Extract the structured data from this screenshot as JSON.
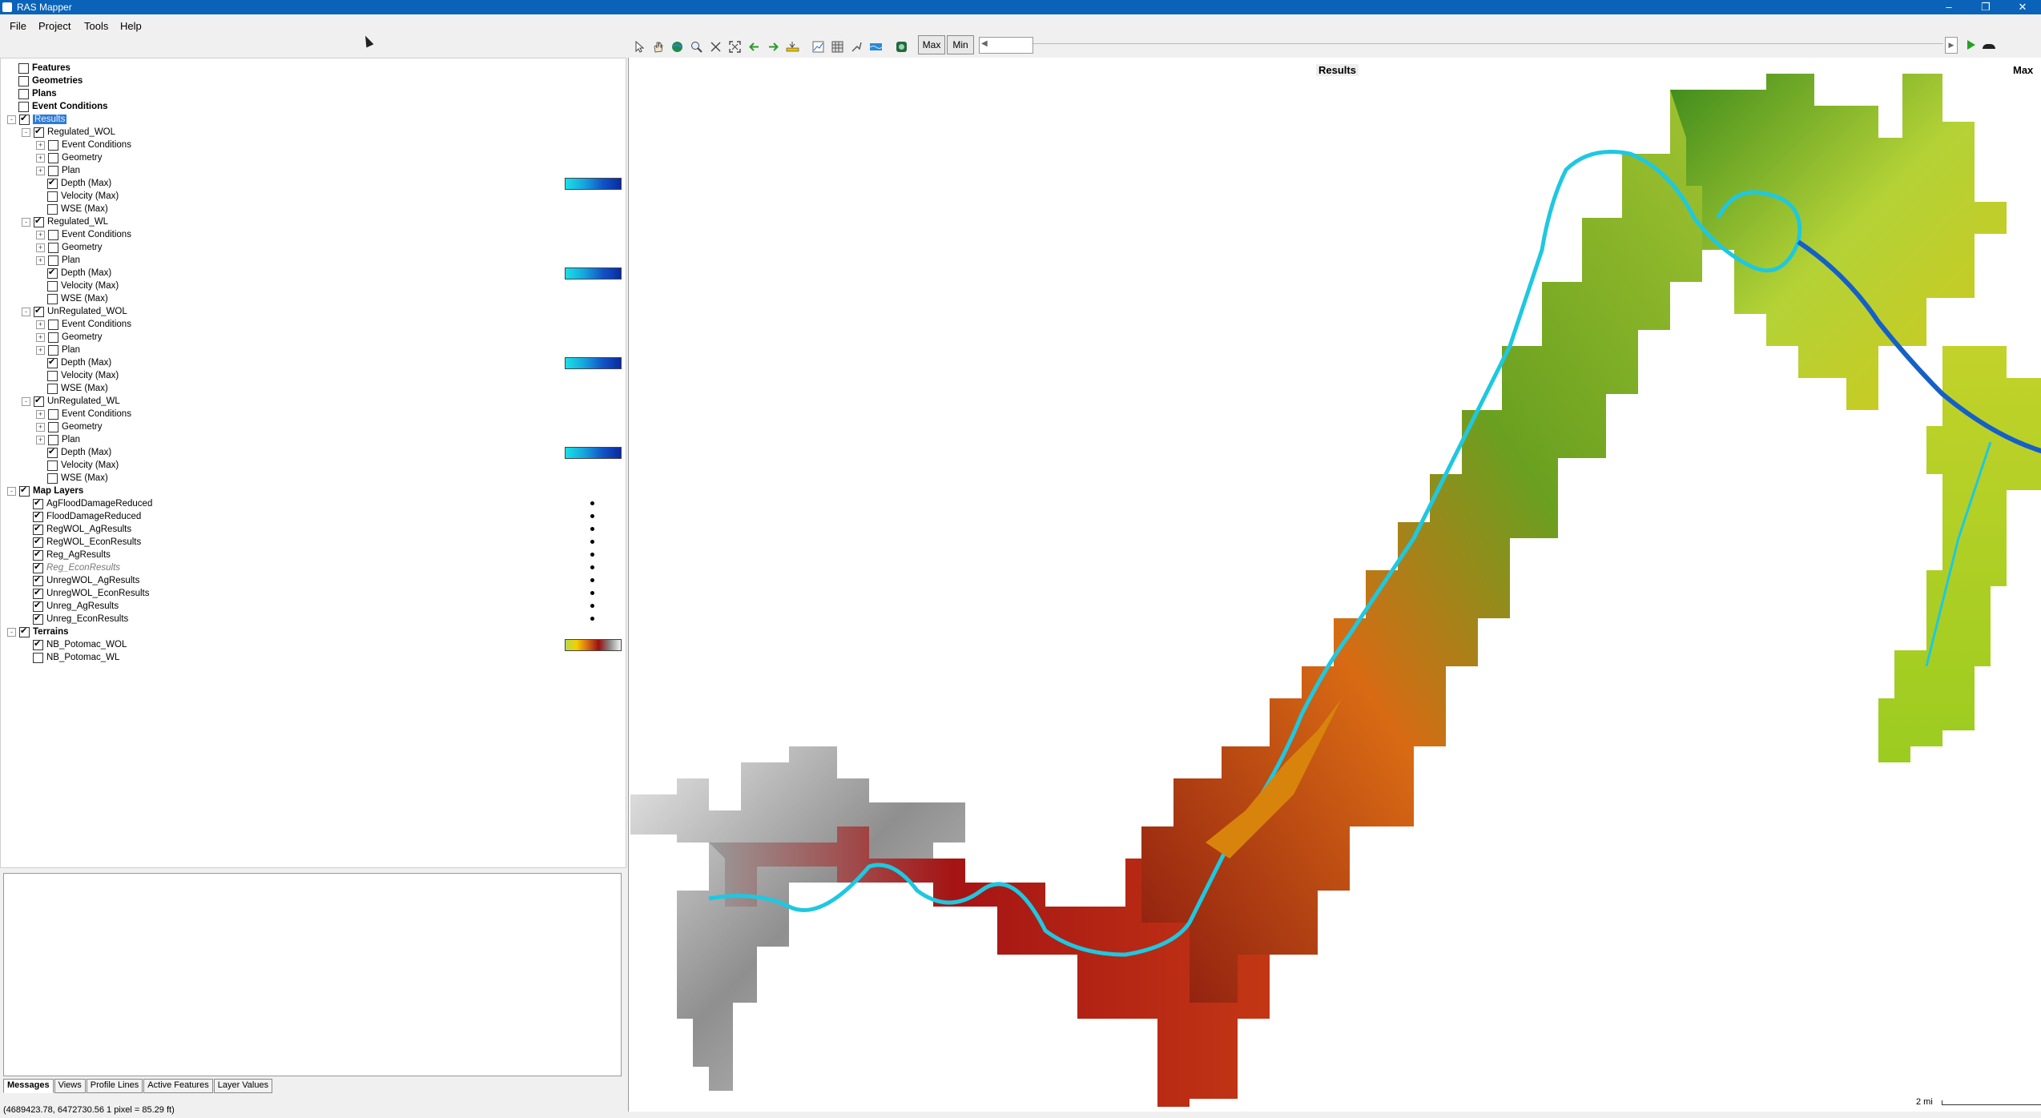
{
  "window": {
    "title": "RAS Mapper",
    "controls": [
      "–",
      "❐",
      "✕"
    ]
  },
  "menu": [
    "File",
    "Project",
    "Tools",
    "Help"
  ],
  "toolbar": {
    "max_label": "Max",
    "min_label": "Min"
  },
  "tree": {
    "top": [
      {
        "label": "Features",
        "checked": false,
        "bold": true
      },
      {
        "label": "Geometries",
        "checked": false,
        "bold": true
      },
      {
        "label": "Plans",
        "checked": false,
        "bold": true
      },
      {
        "label": "Event Conditions",
        "checked": false,
        "bold": true
      }
    ],
    "results_label": "Results",
    "results": [
      {
        "label": "Regulated_WOL",
        "checked": true,
        "children": [
          {
            "label": "Event Conditions",
            "checked": false,
            "expandable": true
          },
          {
            "label": "Geometry",
            "checked": false,
            "expandable": true
          },
          {
            "label": "Plan",
            "checked": false,
            "expandable": true
          },
          {
            "label": "Depth (Max)",
            "checked": true,
            "legend": true
          },
          {
            "label": "Velocity (Max)",
            "checked": false
          },
          {
            "label": "WSE (Max)",
            "checked": false
          }
        ]
      },
      {
        "label": "Regulated_WL",
        "checked": true,
        "children": [
          {
            "label": "Event Conditions",
            "checked": false,
            "expandable": true
          },
          {
            "label": "Geometry",
            "checked": false,
            "expandable": true
          },
          {
            "label": "Plan",
            "checked": false,
            "expandable": true
          },
          {
            "label": "Depth (Max)",
            "checked": true,
            "legend": true
          },
          {
            "label": "Velocity (Max)",
            "checked": false
          },
          {
            "label": "WSE (Max)",
            "checked": false
          }
        ]
      },
      {
        "label": "UnRegulated_WOL",
        "checked": true,
        "children": [
          {
            "label": "Event Conditions",
            "checked": false,
            "expandable": true
          },
          {
            "label": "Geometry",
            "checked": false,
            "expandable": true
          },
          {
            "label": "Plan",
            "checked": false,
            "expandable": true
          },
          {
            "label": "Depth (Max)",
            "checked": true,
            "legend": true
          },
          {
            "label": "Velocity (Max)",
            "checked": false
          },
          {
            "label": "WSE (Max)",
            "checked": false
          }
        ]
      },
      {
        "label": "UnRegulated_WL",
        "checked": true,
        "children": [
          {
            "label": "Event Conditions",
            "checked": false,
            "expandable": true
          },
          {
            "label": "Geometry",
            "checked": false,
            "expandable": true
          },
          {
            "label": "Plan",
            "checked": false,
            "expandable": true
          },
          {
            "label": "Depth (Max)",
            "checked": true,
            "legend": true
          },
          {
            "label": "Velocity (Max)",
            "checked": false
          },
          {
            "label": "WSE (Max)",
            "checked": false
          }
        ]
      }
    ],
    "map_layers_label": "Map Layers",
    "map_layers": [
      {
        "label": "AgFloodDamageReduced",
        "checked": true
      },
      {
        "label": "FloodDamageReduced",
        "checked": true
      },
      {
        "label": "RegWOL_AgResults",
        "checked": true
      },
      {
        "label": "RegWOL_EconResults",
        "checked": true
      },
      {
        "label": "Reg_AgResults",
        "checked": true
      },
      {
        "label": "Reg_EconResults",
        "checked": true,
        "italic": true
      },
      {
        "label": "UnregWOL_AgResults",
        "checked": true
      },
      {
        "label": "UnregWOL_EconResults",
        "checked": true
      },
      {
        "label": "Unreg_AgResults",
        "checked": true
      },
      {
        "label": "Unreg_EconResults",
        "checked": true
      }
    ],
    "terrains_label": "Terrains",
    "terrains": [
      {
        "label": "NB_Potomac_WOL",
        "checked": true,
        "legend": true
      },
      {
        "label": "NB_Potomac_WL",
        "checked": false
      }
    ]
  },
  "bottom_tabs": [
    "Messages",
    "Views",
    "Profile Lines",
    "Active Features",
    "Layer Values"
  ],
  "status": {
    "text": "(4689423.78, 6472730.56  1 pixel = 85.29 ft)"
  },
  "map": {
    "title": "Results",
    "profile": "Max",
    "scale_label": "2 mi"
  },
  "colors": {
    "titlebar": "#0a63b8",
    "depth_shallow": "#19e0e8",
    "depth_deep": "#0a2aa0",
    "terrain_low": "#b8d84a",
    "terrain_high": "#9a1010"
  }
}
